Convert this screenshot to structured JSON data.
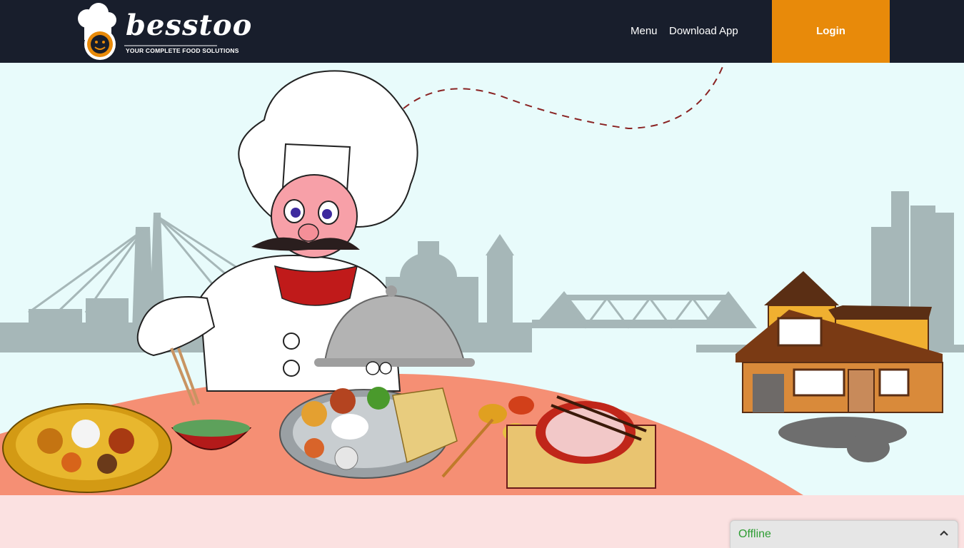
{
  "header": {
    "logo_text": "besstoo",
    "logo_tagline": "YOUR COMPLETE FOOD SOLUTIONS",
    "nav": [
      "Menu",
      "Download App"
    ],
    "login_label": "Login"
  },
  "hero": {
    "illustration": [
      "chef",
      "city-skyline",
      "food-table",
      "house"
    ]
  },
  "chat": {
    "status": "Offline",
    "toggle_icon": "chevron-up-icon"
  },
  "colors": {
    "navbar": "#181e2c",
    "accent": "#e88a0a",
    "hero_bg": "#e8fbfb",
    "table": "#f58f74",
    "chat_status": "#2e9d33"
  }
}
